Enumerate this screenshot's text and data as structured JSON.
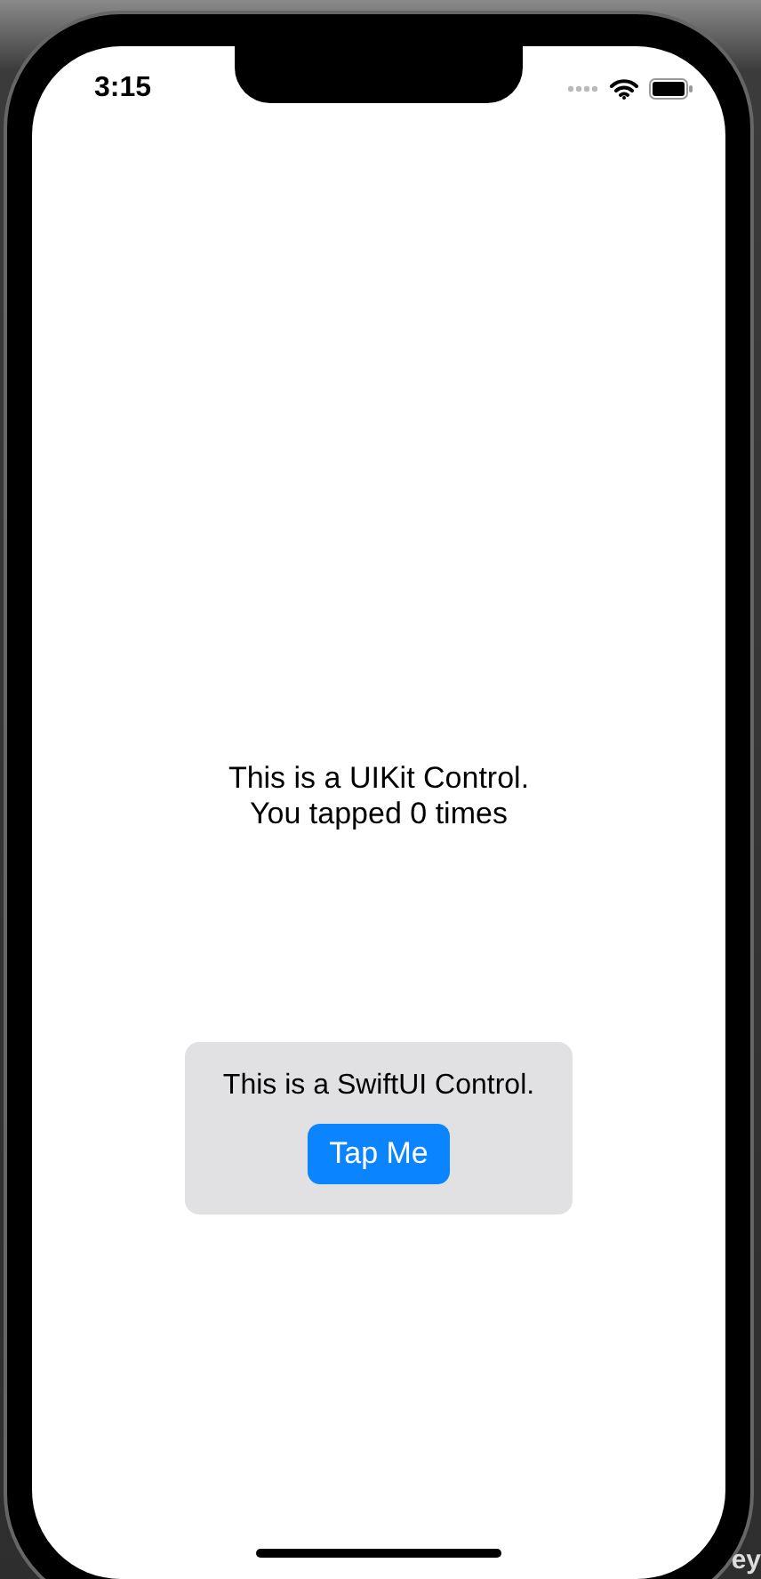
{
  "status_bar": {
    "time": "3:15"
  },
  "uikit_control": {
    "lines": [
      "This is a UIKit Control.",
      "You tapped 0 times"
    ]
  },
  "swiftui_control": {
    "label": "This is a SwiftUI Control.",
    "button": "Tap Me"
  },
  "background_text": "ey"
}
